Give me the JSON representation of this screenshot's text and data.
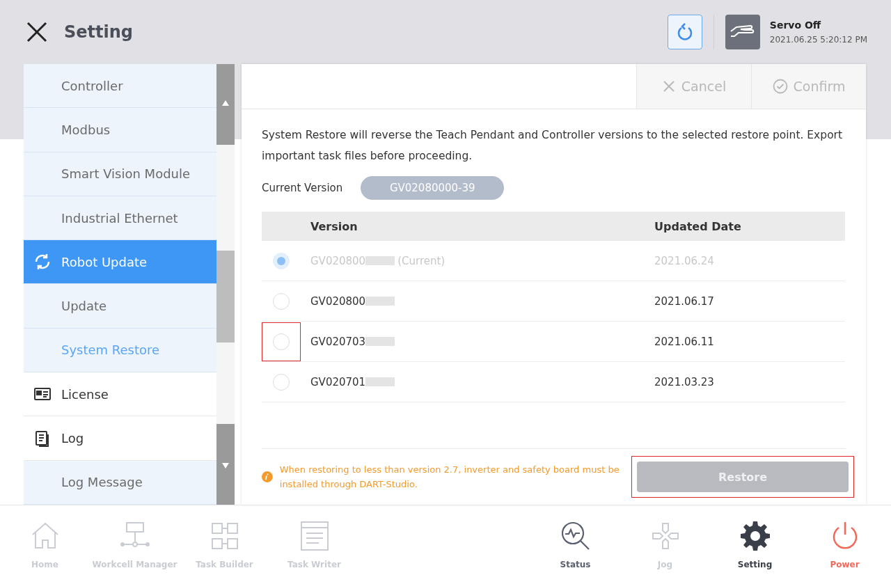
{
  "header": {
    "title": "Setting",
    "servo": {
      "status": "Servo Off",
      "datetime": "2021.06.25 5:20:12 PM"
    }
  },
  "sidebar": {
    "items": [
      {
        "label": "Controller",
        "kind": "sub",
        "selected": false
      },
      {
        "label": "Modbus",
        "kind": "sub",
        "selected": false
      },
      {
        "label": "Smart Vision Module",
        "kind": "sub",
        "selected": false
      },
      {
        "label": "Industrial Ethernet",
        "kind": "sub",
        "selected": false
      },
      {
        "label": "Robot Update",
        "kind": "group",
        "selected": true
      },
      {
        "label": "Update",
        "kind": "sub",
        "selected": false
      },
      {
        "label": "System Restore",
        "kind": "sub",
        "selected": true
      },
      {
        "label": "License",
        "kind": "group",
        "selected": false
      },
      {
        "label": "Log",
        "kind": "group",
        "selected": false
      },
      {
        "label": "Log Message",
        "kind": "sub",
        "selected": false
      }
    ]
  },
  "toolbar": {
    "buttons": [
      {
        "label": "Cancel",
        "disabled": true
      },
      {
        "label": "Confirm",
        "disabled": true
      }
    ]
  },
  "description": "System Restore will reverse the Teach Pendant and Controller versions to the selected restore point. Export important task files before proceeding.",
  "current_version": {
    "label": "Current Version",
    "value": "GV02080000-39"
  },
  "table": {
    "columns": [
      "Version",
      "Updated Date"
    ],
    "rows": [
      {
        "version": "GV020800",
        "suffix": "(Current)",
        "date": "2021.06.24",
        "selected": true,
        "disabled": true,
        "highlighted": false
      },
      {
        "version": "GV020800",
        "date": "2021.06.17",
        "selected": false,
        "disabled": false,
        "highlighted": false
      },
      {
        "version": "GV020703",
        "date": "2021.06.11",
        "selected": false,
        "disabled": false,
        "highlighted": true
      },
      {
        "version": "GV020701",
        "date": "2021.03.23",
        "selected": false,
        "disabled": false,
        "highlighted": false
      }
    ]
  },
  "warning": "When restoring to less than version 2.7, inverter and safety board must be installed through DART-Studio.",
  "restore_button": {
    "label": "Restore",
    "disabled": true,
    "highlighted": true
  },
  "bottom_nav": {
    "left": [
      {
        "label": "Home",
        "disabled": true,
        "selected": false,
        "kind": "nav"
      },
      {
        "label": "Workcell Manager",
        "disabled": true,
        "selected": false,
        "kind": "nav"
      },
      {
        "label": "Task Builder",
        "disabled": true,
        "selected": false,
        "kind": "nav"
      },
      {
        "label": "Task Writer",
        "disabled": true,
        "selected": false,
        "kind": "nav"
      }
    ],
    "right": [
      {
        "label": "Status",
        "disabled": false,
        "selected": false,
        "kind": "nav"
      },
      {
        "label": "Jog",
        "disabled": true,
        "selected": false,
        "kind": "nav"
      },
      {
        "label": "Setting",
        "disabled": false,
        "selected": true,
        "kind": "nav"
      },
      {
        "label": "Power",
        "disabled": false,
        "selected": false,
        "kind": "power"
      }
    ]
  }
}
